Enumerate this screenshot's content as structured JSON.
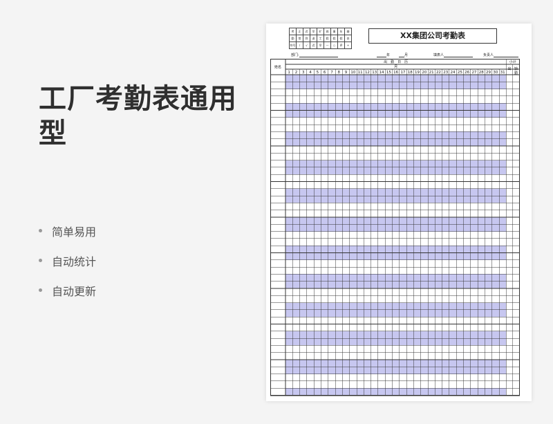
{
  "title": "工厂考勤表通用型",
  "features": [
    "简单易用",
    "自动统计",
    "自动更新"
  ],
  "sheet": {
    "doc_title": "XX集团公司考勤表",
    "legend": {
      "headers": [
        "考",
        "正",
        "迟",
        "早",
        "旷",
        "病",
        "事",
        "年",
        "婚"
      ],
      "row2": [
        "勤",
        "常",
        "到",
        "退",
        "工",
        "假",
        "假",
        "假",
        "丧"
      ],
      "symbols": [
        "符号",
        "/",
        "√",
        "迟",
        "早",
        "—",
        "○",
        "Ø",
        "+"
      ]
    },
    "info": {
      "dept": "部门:",
      "year": "年",
      "month": "月",
      "filler": "填表人",
      "leader": "负责人"
    },
    "table": {
      "name_header": "姓名",
      "attendance_header": "出　勤　日　历",
      "month_header": "月",
      "subtotal_header": "小计",
      "col_out": "出",
      "col_absent": "缺",
      "col_attend": "勤",
      "days": [
        "1",
        "2",
        "3",
        "4",
        "5",
        "6",
        "7",
        "8",
        "9",
        "10",
        "11",
        "12",
        "13",
        "14",
        "15",
        "16",
        "17",
        "18",
        "19",
        "20",
        "21",
        "22",
        "23",
        "24",
        "25",
        "26",
        "27",
        "28",
        "29",
        "30",
        "31"
      ],
      "row_count": 45
    },
    "colors": {
      "shade": "#c7c7f0",
      "line": "#333333"
    }
  }
}
